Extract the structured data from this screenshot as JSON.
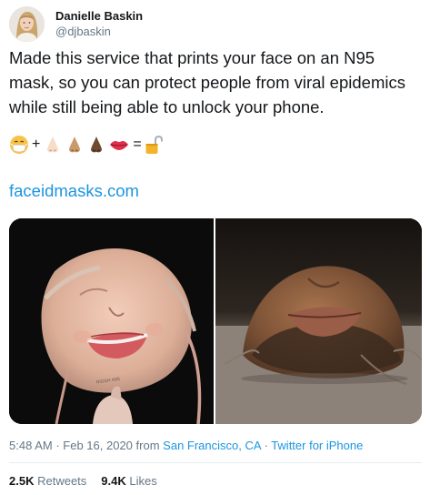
{
  "tweet": {
    "author": {
      "display_name": "Danielle Baskin",
      "handle": "@djbaskin"
    },
    "text": "Made this service that prints your face on an N95 mask, so you can protect people from viral epidemics while still being able to unlock your phone.",
    "emoji_equation": {
      "symbols": [
        "mask-face-emoji",
        "plus",
        "nose-light-emoji",
        "nose-medium-emoji",
        "nose-dark-emoji",
        "lips-emoji",
        "equals",
        "unlocked-padlock-emoji"
      ],
      "plus": "+",
      "equals": "="
    },
    "link": "faceidmasks.com",
    "media": [
      {
        "icon": "mask-photo-smiling-woman"
      },
      {
        "icon": "mask-photo-bearded-man"
      }
    ],
    "meta": {
      "time": "5:48 AM",
      "separator": "·",
      "date": "Feb 16, 2020",
      "from_label": "from",
      "location": "San Francisco, CA",
      "source": "Twitter for iPhone"
    },
    "stats": {
      "retweets_count": "2.5K",
      "retweets_label": "Retweets",
      "likes_count": "9.4K",
      "likes_label": "Likes"
    },
    "colors": {
      "link": "#1b95e0",
      "secondary": "#657786",
      "text": "#14171a",
      "divider": "#e6ecf0"
    }
  }
}
